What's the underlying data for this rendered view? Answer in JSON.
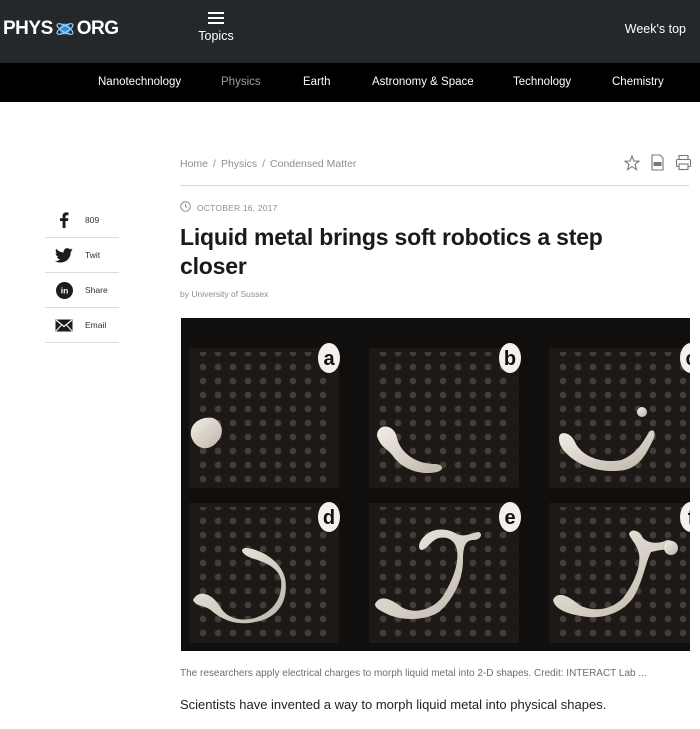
{
  "brand": {
    "logo_left": "PHYS",
    "logo_right": "ORG",
    "logo_icon": "globe-icon"
  },
  "header": {
    "topics_label": "Topics",
    "menu_icon": "hamburger-icon",
    "weeks_top": "Week's top"
  },
  "categories": [
    {
      "label": "Nanotechnology",
      "active": false
    },
    {
      "label": "Physics",
      "active": true
    },
    {
      "label": "Earth",
      "active": false
    },
    {
      "label": "Astronomy & Space",
      "active": false
    },
    {
      "label": "Technology",
      "active": false
    },
    {
      "label": "Chemistry",
      "active": false
    }
  ],
  "breadcrumb": [
    "Home",
    "Physics",
    "Condensed Matter"
  ],
  "tools": [
    "star-icon",
    "pdf-icon",
    "print-icon"
  ],
  "share": [
    {
      "icon": "facebook-icon",
      "label": "809"
    },
    {
      "icon": "twitter-icon",
      "label": "Twit"
    },
    {
      "icon": "linkedin-icon",
      "label": "Share"
    },
    {
      "icon": "email-icon",
      "label": "Email"
    }
  ],
  "article": {
    "date": "OCTOBER 16, 2017",
    "title": "Liquid metal brings soft robotics a step closer",
    "byline": "by University of Sussex",
    "image_panels": [
      "a",
      "b",
      "c",
      "d",
      "e",
      "f"
    ],
    "caption": "The researchers apply electrical charges to morph liquid metal into 2-D shapes. Credit: INTERACT Lab ...",
    "lede": "Scientists have invented a way to morph liquid metal into physical shapes."
  },
  "colors": {
    "topbar": "#25282b",
    "catnav": "#000000",
    "muted": "#8a8f94",
    "logo_accent": "#2d8fd5"
  }
}
